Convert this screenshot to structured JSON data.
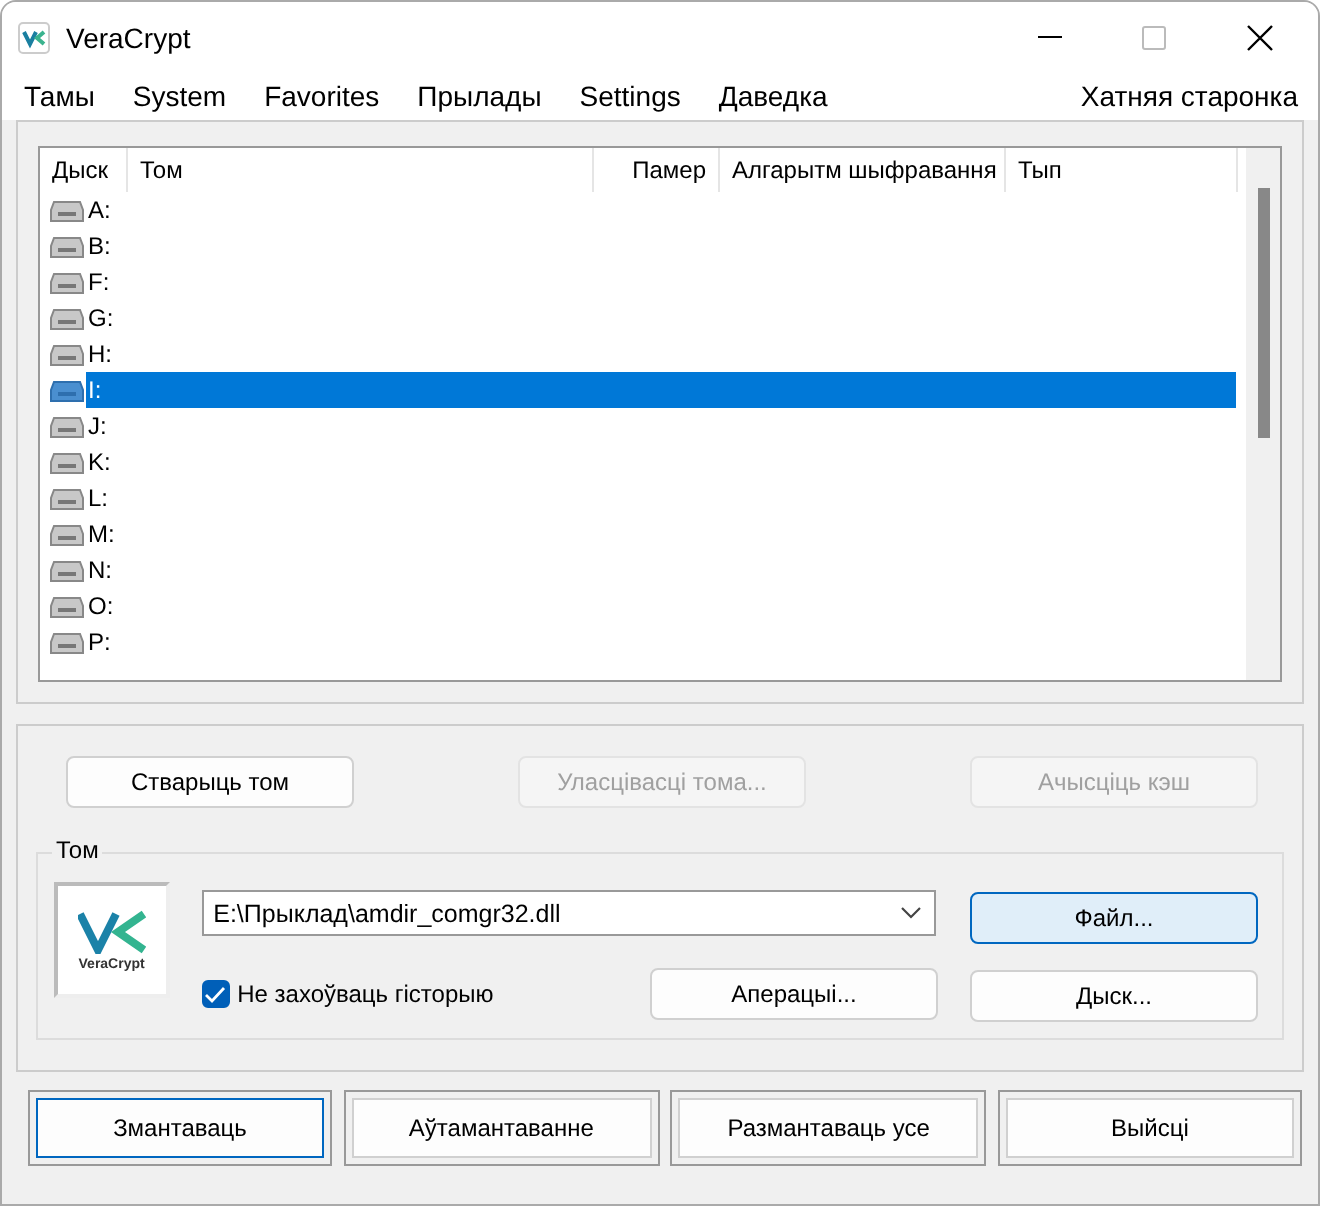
{
  "window": {
    "title": "VeraCrypt"
  },
  "menu": [
    "Тамы",
    "System",
    "Favorites",
    "Прылады",
    "Settings",
    "Даведка"
  ],
  "homepage_link": "Хатняя старонка",
  "drive_list": {
    "columns": [
      "Дыск",
      "Том",
      "Памер",
      "Алгарытм шыфравання",
      "Тып"
    ],
    "rows": [
      {
        "drive": "A:",
        "selected": false
      },
      {
        "drive": "B:",
        "selected": false
      },
      {
        "drive": "F:",
        "selected": false
      },
      {
        "drive": "G:",
        "selected": false
      },
      {
        "drive": "H:",
        "selected": false
      },
      {
        "drive": "I:",
        "selected": true
      },
      {
        "drive": "J:",
        "selected": false
      },
      {
        "drive": "K:",
        "selected": false
      },
      {
        "drive": "L:",
        "selected": false
      },
      {
        "drive": "M:",
        "selected": false
      },
      {
        "drive": "N:",
        "selected": false
      },
      {
        "drive": "O:",
        "selected": false
      },
      {
        "drive": "P:",
        "selected": false
      }
    ]
  },
  "action_buttons": [
    {
      "label": "Стварыць том",
      "disabled": false
    },
    {
      "label": "Уласцівасці тома...",
      "disabled": true
    },
    {
      "label": "Ачысціць кэш",
      "disabled": true
    }
  ],
  "volume": {
    "title": "Том",
    "path": "E:\\Прыклад\\amdir_comgr32.dll",
    "logo_text": "VeraCrypt",
    "never_save_history": {
      "label": "Не захоўваць гісторыю",
      "checked": true
    },
    "buttons": [
      {
        "label": "Файл...",
        "highlighted": true
      },
      {
        "label": "Аперацыі...",
        "highlighted": false
      },
      {
        "label": "Дыск...",
        "highlighted": false
      }
    ]
  },
  "bottom_buttons": [
    {
      "label": "Змантаваць",
      "default": true
    },
    {
      "label": "Аўтамантаванне",
      "default": false
    },
    {
      "label": "Размантаваць усе",
      "default": false
    },
    {
      "label": "Выйсці",
      "default": false
    }
  ]
}
